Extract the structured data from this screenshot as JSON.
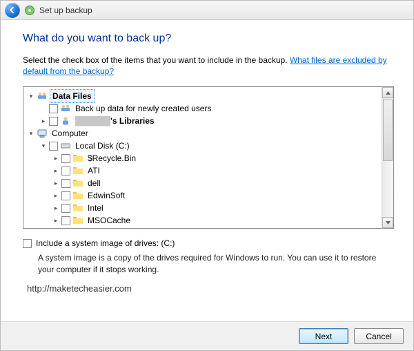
{
  "titlebar": {
    "title": "Set up backup"
  },
  "heading": "What do you want to back up?",
  "instruction_prefix": "Select the check box of the items that you want to include in the backup. ",
  "instruction_link": "What files are excluded by default from the backup?",
  "tree": {
    "data_files": {
      "label": "Data Files",
      "new_users": "Back up data for newly created users",
      "user_lib": "'s Libraries",
      "user_lib_prefix": "██████"
    },
    "computer": {
      "label": "Computer",
      "drive": "Local Disk (C:)",
      "folders": [
        "$Recycle.Bin",
        "ATI",
        "dell",
        "EdwinSoft",
        "Intel",
        "MSOCache"
      ]
    }
  },
  "system_image": {
    "label": "Include a system image of drives: (C:)",
    "description": "A system image is a copy of the drives required for Windows to run. You can use it to restore your computer if it stops working."
  },
  "watermark": "http://maketecheasier.com",
  "buttons": {
    "next": "Next",
    "cancel": "Cancel"
  }
}
